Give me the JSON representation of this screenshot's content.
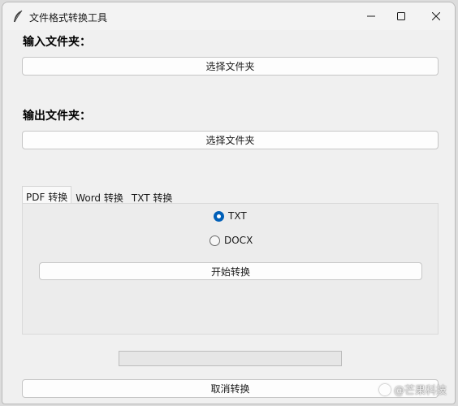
{
  "window": {
    "title": "文件格式转换工具",
    "icon": "feather-icon"
  },
  "input_section": {
    "label": "输入文件夹：",
    "button_label": "选择文件夹"
  },
  "output_section": {
    "label": "输出文件夹：",
    "button_label": "选择文件夹"
  },
  "tabs": [
    {
      "label": "PDF 转换",
      "active": true
    },
    {
      "label": "Word 转换",
      "active": false
    },
    {
      "label": "TXT 转换",
      "active": false
    }
  ],
  "pdf_panel": {
    "options": [
      {
        "label": "TXT",
        "selected": true
      },
      {
        "label": "DOCX",
        "selected": false
      }
    ],
    "start_button_label": "开始转换"
  },
  "progress": {
    "value": 0
  },
  "cancel_button_label": "取消转换",
  "watermark": {
    "text": "@芒果科技"
  },
  "colors": {
    "accent": "#005fb8",
    "window_bg": "#f0f0f0"
  }
}
